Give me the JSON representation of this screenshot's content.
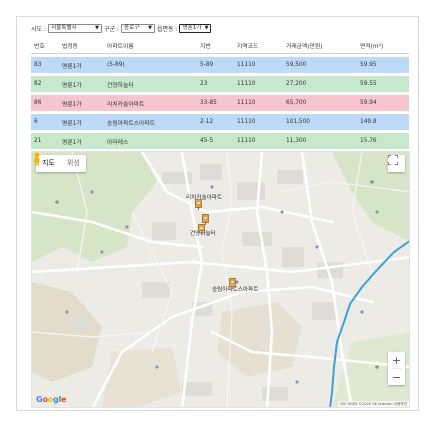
{
  "filters": {
    "sido_label": "시도 :",
    "sido_value": "서울특별시",
    "gugun_label": "구군 :",
    "gugun_value": "종로구",
    "dong_label": "읍면동 :",
    "dong_value": "명륜1가"
  },
  "table": {
    "headers": [
      "번호",
      "법정동",
      "아파트이름",
      "지번",
      "지역코드",
      "거래금액(만원)",
      "면적(m²)"
    ],
    "rows": [
      {
        "no": "83",
        "dong": "명륜1가",
        "name": "(5-89)",
        "jibun": "5-89",
        "code": "11110",
        "price": "59,500",
        "area": "59.95",
        "color": "#bcd9f8"
      },
      {
        "no": "82",
        "dong": "명륜1가",
        "name": "건양하늘터",
        "jibun": "23",
        "code": "11110",
        "price": "27,200",
        "area": "59.55",
        "color": "#c8e8cd"
      },
      {
        "no": "86",
        "dong": "명륜1가",
        "name": "리치카슬아파트",
        "jibun": "33-85",
        "code": "11110",
        "price": "65,700",
        "area": "59.94",
        "color": "#f6c5ce"
      },
      {
        "no": "6",
        "dong": "명륜1가",
        "name": "숭림아파트스아파트",
        "jibun": "2-12",
        "code": "11110",
        "price": "101,500",
        "area": "149.8",
        "color": "#bcd9f8"
      },
      {
        "no": "21",
        "dong": "명륜1가",
        "name": "아마레스",
        "jibun": "45-5",
        "code": "11110",
        "price": "11,300",
        "area": "15.76",
        "color": "#c8e8cd"
      }
    ]
  },
  "map": {
    "tab_map": "지도",
    "tab_satellite": "위성",
    "google": [
      "G",
      "o",
      "o",
      "g",
      "l",
      "e"
    ],
    "google_colors": [
      "#4285f4",
      "#ea4335",
      "#fbbc05",
      "#4285f4",
      "#34a853",
      "#ea4335"
    ],
    "attribution": "지도 데이터 ©2020 SK telecom   이용약관",
    "labels": [
      {
        "text": "리치카슬아파트"
      },
      {
        "text": "건양하늘터"
      },
      {
        "text": "숭림아파트스아파트"
      }
    ],
    "zoom_in": "+",
    "zoom_out": "−",
    "icons": [
      "fullscreen-icon",
      "pegman-icon",
      "apartment-marker-icon"
    ]
  }
}
